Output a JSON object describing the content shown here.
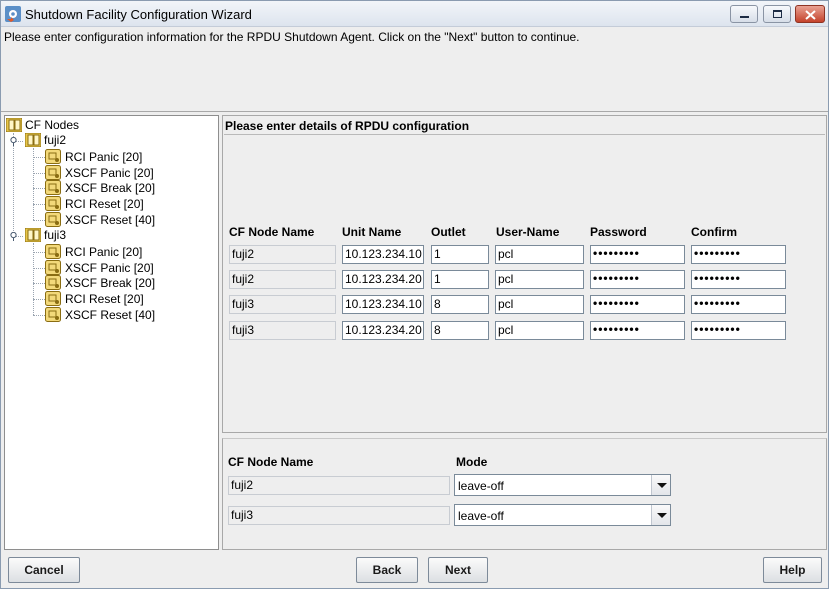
{
  "window": {
    "title": "Shutdown Facility Configuration Wizard",
    "instruction": "Please enter configuration information for the RPDU Shutdown Agent. Click on the \"Next\" button to continue."
  },
  "tree": {
    "root": "CF Nodes",
    "nodes": [
      {
        "name": "fuji2",
        "agents": [
          "RCI Panic [20]",
          "XSCF Panic [20]",
          "XSCF Break [20]",
          "RCI Reset [20]",
          "XSCF Reset [40]"
        ]
      },
      {
        "name": "fuji3",
        "agents": [
          "RCI Panic [20]",
          "XSCF Panic [20]",
          "XSCF Break [20]",
          "RCI Reset [20]",
          "XSCF Reset [40]"
        ]
      }
    ]
  },
  "rpdu": {
    "heading": "Please enter details of RPDU configuration",
    "columns": [
      "CF Node Name",
      "Unit Name",
      "Outlet",
      "User-Name",
      "Password",
      "Confirm"
    ],
    "rows": [
      {
        "node": "fuji2",
        "unit": "10.123.234.10",
        "outlet": "1",
        "user": "pcl",
        "password": "•••••••••",
        "confirm": "•••••••••"
      },
      {
        "node": "fuji2",
        "unit": "10.123.234.20",
        "outlet": "1",
        "user": "pcl",
        "password": "•••••••••",
        "confirm": "•••••••••"
      },
      {
        "node": "fuji3",
        "unit": "10.123.234.10",
        "outlet": "8",
        "user": "pcl",
        "password": "•••••••••",
        "confirm": "•••••••••"
      },
      {
        "node": "fuji3",
        "unit": "10.123.234.20",
        "outlet": "8",
        "user": "pcl",
        "password": "•••••••••",
        "confirm": "•••••••••"
      }
    ]
  },
  "mode": {
    "columns": [
      "CF Node Name",
      "Mode"
    ],
    "rows": [
      {
        "node": "fuji2",
        "mode": "leave-off"
      },
      {
        "node": "fuji3",
        "mode": "leave-off"
      }
    ]
  },
  "buttons": {
    "cancel": "Cancel",
    "back": "Back",
    "next": "Next",
    "help": "Help"
  },
  "icons": {
    "app": "gear-arrow-icon",
    "folder": "folder-icon",
    "agent": "shutdown-agent-icon",
    "toggle": "tree-expanded-icon",
    "dropdown": "chevron-down-icon"
  },
  "colors": {
    "tree_folder": "#e8c64a",
    "close_button": "#c4422b",
    "field_border": "#7a8a99"
  }
}
